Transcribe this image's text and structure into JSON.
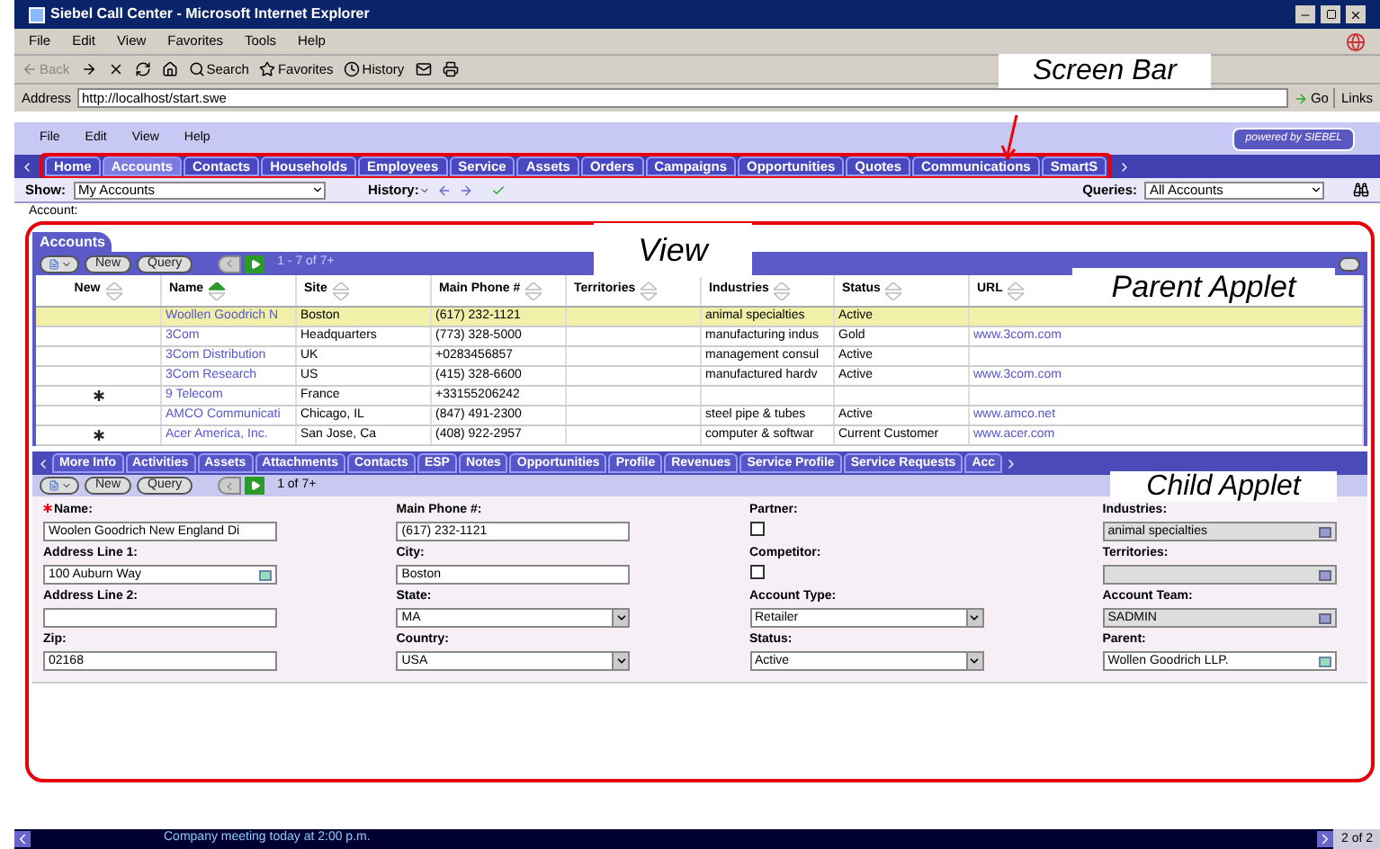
{
  "window": {
    "title": "Siebel Call Center - Microsoft Internet Explorer"
  },
  "ie_menu": [
    "File",
    "Edit",
    "View",
    "Favorites",
    "Tools",
    "Help"
  ],
  "ie_toolbar": {
    "back": "Back",
    "search": "Search",
    "favorites": "Favorites",
    "history": "History"
  },
  "address": {
    "label": "Address",
    "value": "http://localhost/start.swe",
    "go": "Go",
    "links": "Links"
  },
  "app_menu": [
    "File",
    "Edit",
    "View",
    "Help"
  ],
  "brand": "powered by SIEBEL",
  "screen_tabs": [
    {
      "label": "Home",
      "selected": false
    },
    {
      "label": "Accounts",
      "selected": true
    },
    {
      "label": "Contacts",
      "selected": false
    },
    {
      "label": "Households",
      "selected": false
    },
    {
      "label": "Employees",
      "selected": false
    },
    {
      "label": "Service",
      "selected": false
    },
    {
      "label": "Assets",
      "selected": false
    },
    {
      "label": "Orders",
      "selected": false
    },
    {
      "label": "Campaigns",
      "selected": false
    },
    {
      "label": "Opportunities",
      "selected": false
    },
    {
      "label": "Quotes",
      "selected": false
    },
    {
      "label": "Communications",
      "selected": false
    },
    {
      "label": "SmartS",
      "selected": false
    }
  ],
  "show": {
    "label": "Show:",
    "value": "My Accounts"
  },
  "history": "History:",
  "queries": {
    "label": "Queries:",
    "value": "All Accounts"
  },
  "breadcrumb": "Account:",
  "parent_applet": {
    "title": "Accounts",
    "buttons": [
      "New",
      "Query"
    ],
    "record_count": "1 - 7 of 7+",
    "columns": [
      {
        "label": "New",
        "sorted": false
      },
      {
        "label": "Name",
        "sorted": true
      },
      {
        "label": "Site",
        "sorted": false
      },
      {
        "label": "Main Phone #",
        "sorted": false
      },
      {
        "label": "Territories",
        "sorted": false
      },
      {
        "label": "Industries",
        "sorted": false
      },
      {
        "label": "Status",
        "sorted": false
      },
      {
        "label": "URL",
        "sorted": false
      }
    ],
    "rows": [
      {
        "selected": true,
        "new": false,
        "cells": [
          "",
          "Woollen Goodrich N",
          "Boston",
          "(617) 232-1121",
          "",
          "animal specialties",
          "Active",
          ""
        ]
      },
      {
        "selected": false,
        "new": false,
        "cells": [
          "",
          "3Com",
          "Headquarters",
          "(773) 328-5000",
          "",
          "manufacturing indus",
          "Gold",
          "www.3com.com"
        ]
      },
      {
        "selected": false,
        "new": false,
        "cells": [
          "",
          "3Com Distribution",
          "UK",
          "+0283456857",
          "",
          "management consul",
          "Active",
          ""
        ]
      },
      {
        "selected": false,
        "new": false,
        "cells": [
          "",
          "3Com Research",
          "US",
          "(415) 328-6600",
          "",
          "manufactured hardv",
          "Active",
          "www.3com.com"
        ]
      },
      {
        "selected": false,
        "new": true,
        "cells": [
          "",
          "9 Telecom",
          "France",
          "+33155206242",
          "",
          "",
          "",
          ""
        ]
      },
      {
        "selected": false,
        "new": false,
        "cells": [
          "",
          "AMCO Communicati",
          "Chicago, IL",
          "(847) 491-2300",
          "",
          "steel pipe & tubes",
          "Active",
          "www.amco.net"
        ]
      },
      {
        "selected": false,
        "new": true,
        "cells": [
          "",
          "Acer America, Inc.",
          "San Jose, Ca",
          "(408) 922-2957",
          "",
          "computer & softwar",
          "Current Customer",
          "www.acer.com"
        ]
      }
    ]
  },
  "child_tabs": [
    "More Info",
    "Activities",
    "Assets",
    "Attachments",
    "Contacts",
    "ESP",
    "Notes",
    "Opportunities",
    "Profile",
    "Revenues",
    "Service Profile",
    "Service Requests",
    "Acc"
  ],
  "child_applet": {
    "buttons": [
      "New",
      "Query"
    ],
    "record_count": "1 of 7+",
    "fields": [
      {
        "label": "Name:",
        "required": true,
        "kind": "text",
        "value": "Woolen Goodrich New England Di"
      },
      {
        "label": "Main Phone #:",
        "kind": "text",
        "value": "(617) 232-1121"
      },
      {
        "label": "Partner:",
        "kind": "checkbox",
        "checked": false
      },
      {
        "label": "Industries:",
        "kind": "readonly",
        "value": "animal specialties"
      },
      {
        "label": "Address Line 1:",
        "kind": "pick",
        "value": "100 Auburn Way"
      },
      {
        "label": "City:",
        "kind": "text",
        "value": "Boston"
      },
      {
        "label": "Competitor:",
        "kind": "checkbox",
        "checked": false
      },
      {
        "label": "Territories:",
        "kind": "readonly"
      },
      {
        "label": "Address Line 2:",
        "kind": "text"
      },
      {
        "label": "State:",
        "kind": "select",
        "value": "MA"
      },
      {
        "label": "Account Type:",
        "kind": "select",
        "value": "Retailer"
      },
      {
        "label": "Account Team:",
        "kind": "readonly",
        "value": "SADMIN"
      },
      {
        "label": "Zip:",
        "kind": "text",
        "value": "02168"
      },
      {
        "label": "Country:",
        "kind": "select",
        "value": "USA"
      },
      {
        "label": "Status:",
        "kind": "select",
        "value": "Active"
      },
      {
        "label": "Parent:",
        "kind": "pick",
        "value": "Wollen Goodrich LLP."
      }
    ]
  },
  "status_bar": {
    "message": "Company meeting today at 2:00 p.m.",
    "page": "2 of 2"
  },
  "callouts": [
    "Screen Bar",
    "View",
    "Parent Applet",
    "Child Applet"
  ]
}
